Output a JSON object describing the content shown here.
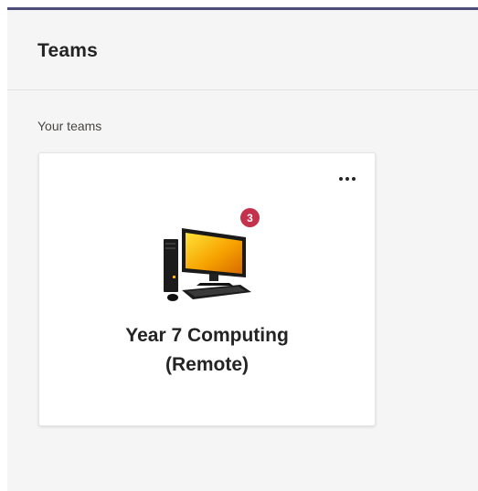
{
  "header": {
    "title": "Teams"
  },
  "section": {
    "label": "Your teams"
  },
  "teams": [
    {
      "name_line1": "Year 7 Computing",
      "name_line2": "(Remote)",
      "badge_count": "3",
      "icon": "desktop-computer-icon",
      "more_icon": "more-options-icon"
    }
  ],
  "colors": {
    "accent_bar": "#4b4d78",
    "badge": "#c4314b",
    "background": "#f5f5f5",
    "card": "#ffffff"
  }
}
